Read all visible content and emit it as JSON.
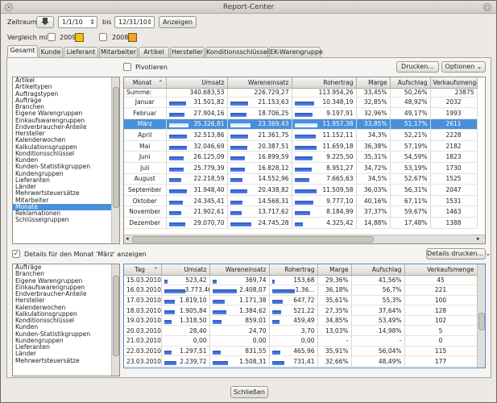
{
  "window": {
    "title": "Report-Center"
  },
  "filter": {
    "zeitraum_label": "Zeitraum:",
    "date_from": "1/1/10",
    "bis_label": "bis",
    "date_to": "12/31/10",
    "anzeigen_label": "Anzeigen",
    "vergleich_label": "Vergleich mit",
    "compare_year_1": "2009",
    "compare_year_2": "2008",
    "colors": {
      "swatch_1": "#f2c21b",
      "swatch_2": "#f0a22a"
    }
  },
  "tabs": [
    "Gesamt",
    "Kunde",
    "Lieferant",
    "Mitarbeiter",
    "Artikel",
    "Hersteller",
    "Konditionsschlüssel",
    "EK-Warengruppe"
  ],
  "toolbar": {
    "pivot_label": "Pivotieren",
    "print_label": "Drucken...",
    "options_label": "Optionen"
  },
  "left_list": [
    "Artikel",
    "Artikeltypen",
    "Auftragstypen",
    "Aufträge",
    "Branchen",
    "Eigene Warengruppen",
    "Einkaufswarengruppen",
    "Endverbraucher-Anteile",
    "Hersteller",
    "Kalenderwochen",
    "Kalkulationsgruppen",
    "Konditionsschlüssel",
    "Kunden",
    "Kunden-Statistikgruppen",
    "Kundengruppen",
    "Lieferanten",
    "Länder",
    "Mehrwertsteuersätze",
    "Mitarbeiter",
    "Monate",
    "Reklamationen",
    "Schlüsselgruppen"
  ],
  "left_list_selected": "Monate",
  "main_table": {
    "headers": [
      "Monat",
      "Umsatz",
      "Wareneinsatz",
      "Rohertrag",
      "Marge",
      "Aufschlag",
      "Verkaufsmenge"
    ],
    "summary": {
      "label": "Summe:",
      "umsatz": "340.683,53",
      "wareneinsatz": "226.729,27",
      "rohertrag": "113.954,26",
      "marge": "33,45%",
      "aufschlag": "50,26%",
      "menge": "23875"
    },
    "rows": [
      {
        "monat": "Januar",
        "umsatz": "31.501,82",
        "wareneinsatz": "21.153,63",
        "rohertrag": "10.348,19",
        "marge": "32,85%",
        "aufschlag": "48,92%",
        "menge": "2032",
        "u": 31501.82,
        "w": 21153.63,
        "r": 10348.19
      },
      {
        "monat": "Februar",
        "umsatz": "27.904,16",
        "wareneinsatz": "18.706,25",
        "rohertrag": "9.197,91",
        "marge": "32,96%",
        "aufschlag": "49,17%",
        "menge": "1993",
        "u": 27904.16,
        "w": 18706.25,
        "r": 9197.91
      },
      {
        "monat": "März",
        "umsatz": "35.326,81",
        "wareneinsatz": "23.369,43",
        "rohertrag": "11.957,38",
        "marge": "33,85%",
        "aufschlag": "51,17%",
        "menge": "2611",
        "u": 35326.81,
        "w": 23369.43,
        "r": 11957.38
      },
      {
        "monat": "April",
        "umsatz": "32.513,86",
        "wareneinsatz": "21.361,75",
        "rohertrag": "11.152,11",
        "marge": "34,3%",
        "aufschlag": "52,21%",
        "menge": "2228",
        "u": 32513.86,
        "w": 21361.75,
        "r": 11152.11
      },
      {
        "monat": "Mai",
        "umsatz": "32.046,69",
        "wareneinsatz": "20.387,51",
        "rohertrag": "11.659,18",
        "marge": "36,38%",
        "aufschlag": "57,19%",
        "menge": "2182",
        "u": 32046.69,
        "w": 20387.51,
        "r": 11659.18
      },
      {
        "monat": "Juni",
        "umsatz": "26.125,09",
        "wareneinsatz": "16.899,59",
        "rohertrag": "9.225,50",
        "marge": "35,31%",
        "aufschlag": "54,59%",
        "menge": "1823",
        "u": 26125.09,
        "w": 16899.59,
        "r": 9225.5
      },
      {
        "monat": "Juli",
        "umsatz": "25.779,39",
        "wareneinsatz": "16.828,12",
        "rohertrag": "8.951,27",
        "marge": "34,72%",
        "aufschlag": "53,19%",
        "menge": "1730",
        "u": 25779.39,
        "w": 16828.12,
        "r": 8951.27
      },
      {
        "monat": "August",
        "umsatz": "22.218,59",
        "wareneinsatz": "14.552,96",
        "rohertrag": "7.665,63",
        "marge": "34,5%",
        "aufschlag": "52,67%",
        "menge": "1525",
        "u": 22218.59,
        "w": 14552.96,
        "r": 7665.63
      },
      {
        "monat": "September",
        "umsatz": "31.948,40",
        "wareneinsatz": "20.438,82",
        "rohertrag": "11.509,58",
        "marge": "36,03%",
        "aufschlag": "56,31%",
        "menge": "2047",
        "u": 31948.4,
        "w": 20438.82,
        "r": 11509.58
      },
      {
        "monat": "Oktober",
        "umsatz": "24.345,41",
        "wareneinsatz": "14.568,31",
        "rohertrag": "9.777,10",
        "marge": "40,16%",
        "aufschlag": "67,11%",
        "menge": "1531",
        "u": 24345.41,
        "w": 14568.31,
        "r": 9777.1
      },
      {
        "monat": "November",
        "umsatz": "21.902,61",
        "wareneinsatz": "13.717,62",
        "rohertrag": "8.184,99",
        "marge": "37,37%",
        "aufschlag": "59,67%",
        "menge": "1463",
        "u": 21902.61,
        "w": 13717.62,
        "r": 8184.99
      },
      {
        "monat": "Dezember",
        "umsatz": "29.070,70",
        "wareneinsatz": "24.745,28",
        "rohertrag": "4.325,42",
        "marge": "14,88%",
        "aufschlag": "17,48%",
        "menge": "1388",
        "u": 29070.7,
        "w": 24745.28,
        "r": 4325.42
      }
    ],
    "selected_index": 2
  },
  "details": {
    "checkbox_label": "Details für den Monat 'März' anzeigen",
    "print_label": "Details drucken..."
  },
  "bottom_list": [
    "Aufträge",
    "Branchen",
    "Eigene Warengruppen",
    "Einkaufswarengruppen",
    "Endverbraucher-Anteile",
    "Hersteller",
    "Kalenderwochen",
    "Kalkulationsgruppen",
    "Konditionsschlüssel",
    "Kunden",
    "Kunden-Statistikgruppen",
    "Kundengruppen",
    "Lieferanten",
    "Länder",
    "Mehrwertsteuersätze"
  ],
  "detail_table": {
    "headers": [
      "Tag",
      "Umsatz",
      "Wareneinsatz",
      "Rohertrag",
      "Marge",
      "Aufschlag",
      "Verkaufsmenge"
    ],
    "rows": [
      {
        "tag": "15.03.2010",
        "umsatz": "523,42",
        "wareneinsatz": "369,74",
        "rohertrag": "153,68",
        "marge": "29,36%",
        "aufschlag": "41,56%",
        "menge": "45",
        "u": 523.42,
        "w": 369.74,
        "r": 153.68
      },
      {
        "tag": "16.03.2010",
        "umsatz": "3.773,46",
        "wareneinsatz": "2.408,07",
        "rohertrag": "1.36...",
        "marge": "36,18%",
        "aufschlag": "56,7%",
        "menge": "221",
        "u": 3773.46,
        "w": 2408.07,
        "r": 1365.39
      },
      {
        "tag": "17.03.2010",
        "umsatz": "1.819,10",
        "wareneinsatz": "1.171,38",
        "rohertrag": "647,72",
        "marge": "35,61%",
        "aufschlag": "55,3%",
        "menge": "100",
        "u": 1819.1,
        "w": 1171.38,
        "r": 647.72
      },
      {
        "tag": "18.03.2010",
        "umsatz": "1.905,84",
        "wareneinsatz": "1.384,62",
        "rohertrag": "521,22",
        "marge": "27,35%",
        "aufschlag": "37,64%",
        "menge": "128",
        "u": 1905.84,
        "w": 1384.62,
        "r": 521.22
      },
      {
        "tag": "19.03.2010",
        "umsatz": "1.318,50",
        "wareneinsatz": "859,01",
        "rohertrag": "459,49",
        "marge": "34,85%",
        "aufschlag": "53,49%",
        "menge": "102",
        "u": 1318.5,
        "w": 859.01,
        "r": 459.49
      },
      {
        "tag": "20.03.2010",
        "umsatz": "28,40",
        "wareneinsatz": "24,70",
        "rohertrag": "3,70",
        "marge": "13,03%",
        "aufschlag": "14,98%",
        "menge": "5",
        "u": 28.4,
        "w": 24.7,
        "r": 3.7
      },
      {
        "tag": "21.03.2010",
        "umsatz": "0,00",
        "wareneinsatz": "0,00",
        "rohertrag": "0,00",
        "marge": "-",
        "aufschlag": "-",
        "menge": "0",
        "u": 0,
        "w": 0,
        "r": 0
      },
      {
        "tag": "22.03.2010",
        "umsatz": "1.297,51",
        "wareneinsatz": "831,55",
        "rohertrag": "465,96",
        "marge": "35,91%",
        "aufschlag": "56,04%",
        "menge": "115",
        "u": 1297.51,
        "w": 831.55,
        "r": 465.96
      },
      {
        "tag": "23.03.2010",
        "umsatz": "2.239,72",
        "wareneinsatz": "1.508,31",
        "rohertrag": "731,41",
        "marge": "32,66%",
        "aufschlag": "48,49%",
        "menge": "177",
        "u": 2239.72,
        "w": 1508.31,
        "r": 731.41
      }
    ]
  },
  "footer": {
    "close_label": "Schließen"
  }
}
